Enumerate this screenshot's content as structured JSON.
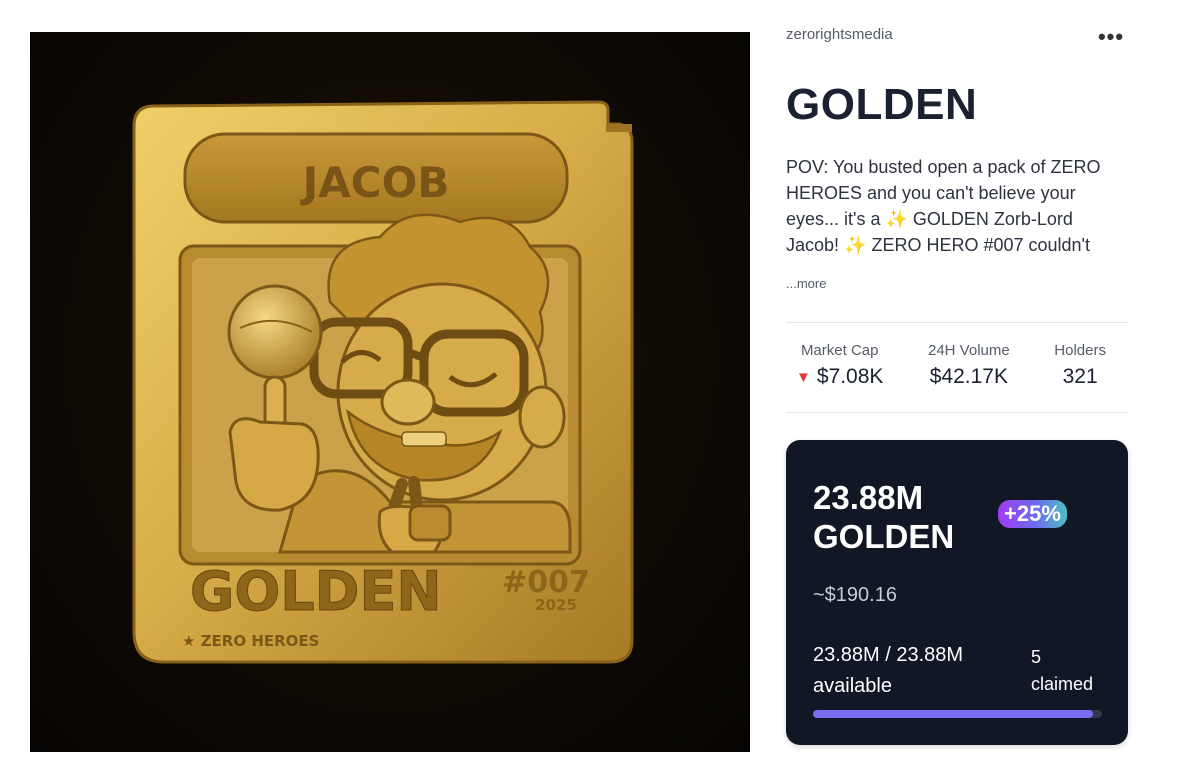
{
  "creator": "zerorightsmedia",
  "menu_icon": "more-horizontal-icon",
  "token": {
    "title": "GOLDEN",
    "description": "POV: You busted open a pack of ZERO HEROES and you can't believe your eyes... it's a ✨ GOLDEN Zorb-Lord Jacob! ✨ ZERO HERO #007 couldn't have been any rarer...",
    "more_label": "...more"
  },
  "artwork": {
    "name": "JACOB",
    "caption": "GOLDEN",
    "number": "#007",
    "year": "2025",
    "series": "★ ZERO HEROES"
  },
  "stats": {
    "market_cap_label": "Market Cap",
    "market_cap_value": "$7.08K",
    "market_cap_trend_icon": "down-triangle-icon",
    "volume_label": "24H Volume",
    "volume_value": "$42.17K",
    "holders_label": "Holders",
    "holders_value": "321"
  },
  "card": {
    "amount_line1": "23.88M",
    "amount_line2": "GOLDEN",
    "badge": "+25%",
    "usd_value": "~$190.16",
    "available_amount": "23.88M / 23.88M",
    "available_label": "available",
    "claimed_count": "5",
    "claimed_label": "claimed",
    "progress_fraction": 0.97
  },
  "colors": {
    "card_bg": "#121726",
    "progress": "#7a6ef0",
    "gold": "#c9a23e",
    "down": "#e03a3a"
  }
}
